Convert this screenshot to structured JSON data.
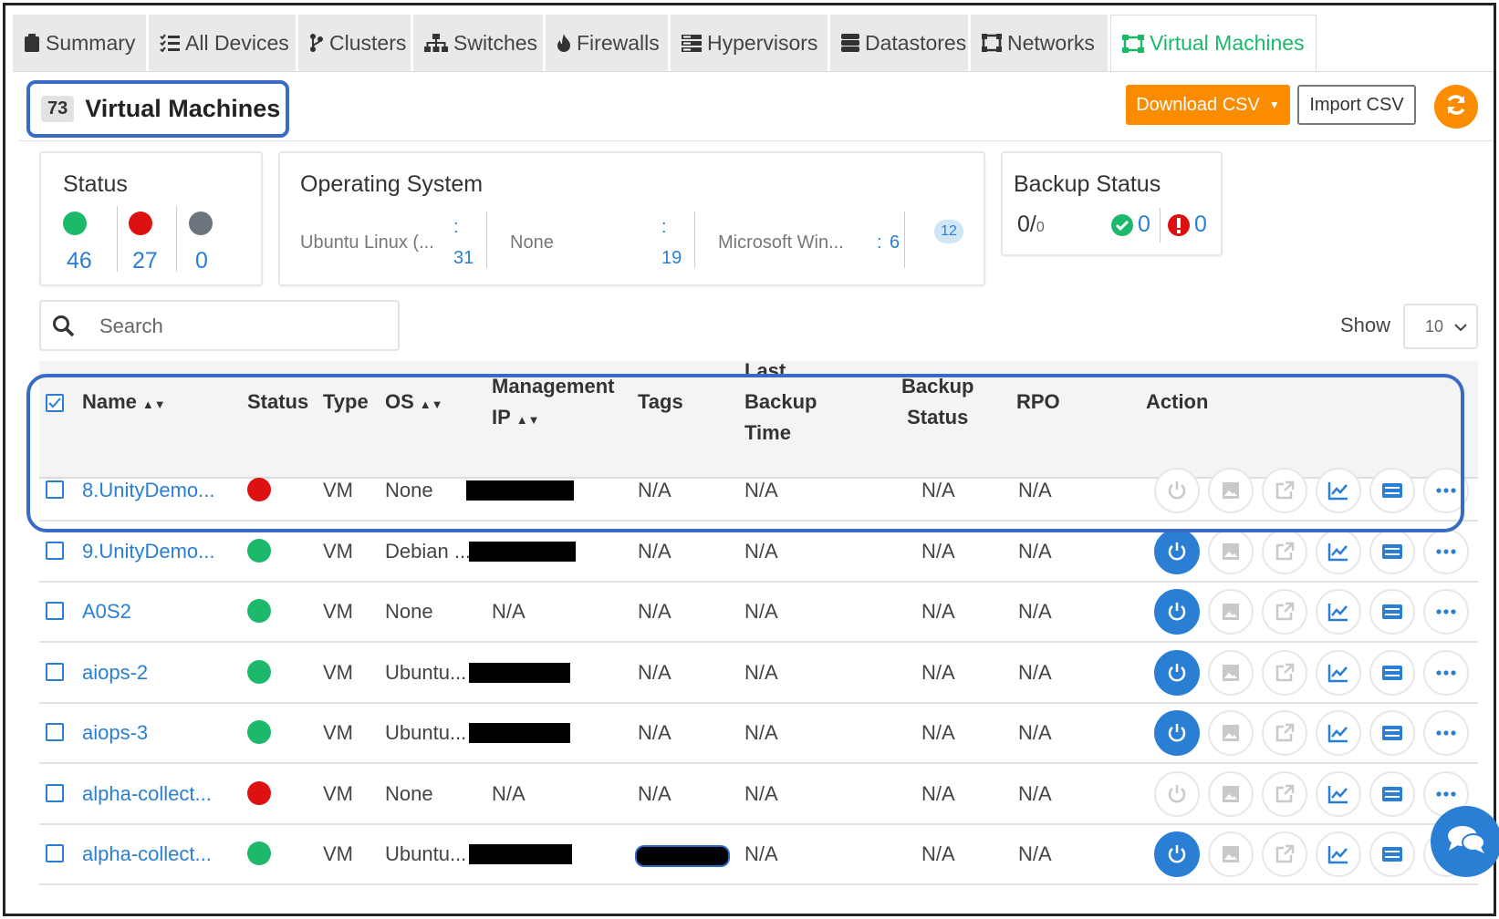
{
  "tabs": [
    {
      "label": "Summary",
      "icon": "clipboard-icon"
    },
    {
      "label": "All Devices",
      "icon": "list-icon"
    },
    {
      "label": "Clusters",
      "icon": "branch-icon"
    },
    {
      "label": "Switches",
      "icon": "sitemap-icon"
    },
    {
      "label": "Firewalls",
      "icon": "fire-icon"
    },
    {
      "label": "Hypervisors",
      "icon": "server-icon"
    },
    {
      "label": "Datastores",
      "icon": "database-icon"
    },
    {
      "label": "Networks",
      "icon": "network-icon"
    },
    {
      "label": "Virtual Machines",
      "icon": "vm-icon",
      "active": true
    }
  ],
  "header": {
    "count": "73",
    "title": "Virtual Machines",
    "download_label": "Download CSV",
    "import_label": "Import CSV"
  },
  "status_card": {
    "title": "Status",
    "counts": [
      {
        "value": "46",
        "color": "#1db96a"
      },
      {
        "value": "27",
        "color": "#dd1111"
      },
      {
        "value": "0",
        "color": "#6c757d"
      }
    ]
  },
  "os_card": {
    "title": "Operating System",
    "items": [
      {
        "label": "Ubuntu Linux (...",
        "sep": ":",
        "count": "31"
      },
      {
        "label": "None",
        "sep": ":",
        "count": "19"
      },
      {
        "label": "Microsoft Win...",
        "sep": ":",
        "count": "6"
      }
    ],
    "more": "12"
  },
  "backup_card": {
    "title": "Backup Status",
    "ratio_main": "0/",
    "ratio_small": "0",
    "success": "0",
    "error": "0"
  },
  "search": {
    "placeholder": "Search"
  },
  "show": {
    "label": "Show",
    "value": "10"
  },
  "table": {
    "columns": {
      "name": "Name",
      "status": "Status",
      "type": "Type",
      "os": "OS",
      "mgmt_ip_1": "Management",
      "mgmt_ip_2": "IP",
      "tags": "Tags",
      "last_backup_1": "Last",
      "last_backup_2": "Backup",
      "last_backup_3": "Time",
      "backup_status_1": "Backup",
      "backup_status_2": "Status",
      "rpo": "RPO",
      "action": "Action"
    },
    "rows": [
      {
        "name": "8.UnityDemo...",
        "status": "#dd1111",
        "type": "VM",
        "os": "None",
        "ip": "",
        "tags": "N/A",
        "last_backup": "N/A",
        "backup_status": "N/A",
        "rpo": "N/A"
      },
      {
        "name": "9.UnityDemo...",
        "status": "#1db96a",
        "type": "VM",
        "os": "Debian ...",
        "ip": "",
        "tags": "N/A",
        "last_backup": "N/A",
        "backup_status": "N/A",
        "rpo": "N/A"
      },
      {
        "name": "A0S2",
        "status": "#1db96a",
        "type": "VM",
        "os": "None",
        "ip": "N/A",
        "tags": "N/A",
        "last_backup": "N/A",
        "backup_status": "N/A",
        "rpo": "N/A"
      },
      {
        "name": "aiops-2",
        "status": "#1db96a",
        "type": "VM",
        "os": "Ubuntu...",
        "ip": "",
        "tags": "N/A",
        "last_backup": "N/A",
        "backup_status": "N/A",
        "rpo": "N/A"
      },
      {
        "name": "aiops-3",
        "status": "#1db96a",
        "type": "VM",
        "os": "Ubuntu...",
        "ip": "",
        "tags": "N/A",
        "last_backup": "N/A",
        "backup_status": "N/A",
        "rpo": "N/A"
      },
      {
        "name": "alpha-collect...",
        "status": "#dd1111",
        "type": "VM",
        "os": "None",
        "ip": "N/A",
        "tags": "N/A",
        "last_backup": "N/A",
        "backup_status": "N/A",
        "rpo": "N/A"
      },
      {
        "name": "alpha-collect...",
        "status": "#1db96a",
        "type": "VM",
        "os": "Ubuntu...",
        "ip": "",
        "tags": "",
        "last_backup": "N/A",
        "backup_status": "N/A",
        "rpo": "N/A"
      }
    ]
  }
}
